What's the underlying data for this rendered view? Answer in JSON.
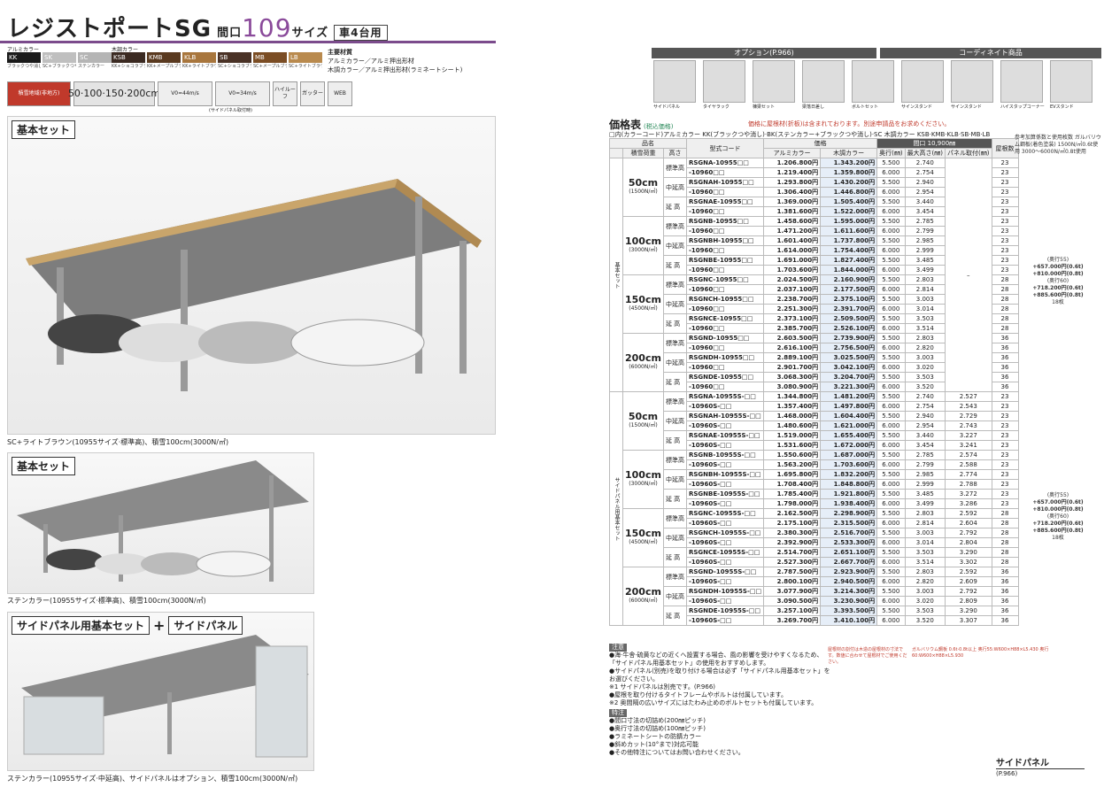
{
  "title": {
    "main": "レジストポートSG",
    "gk": "間口",
    "num": "109",
    "size": "サイズ",
    "badge": "車4台用"
  },
  "swatches": {
    "alum_label": "アルミカラー",
    "wood_label": "木調カラー",
    "alum": [
      {
        "code": "KK",
        "cap": "ブラックつや消し",
        "color": "#1a1a1a"
      },
      {
        "code": "SK",
        "cap": "SC+ブラックつや消し",
        "color": "#bfbfbf"
      },
      {
        "code": "SC",
        "cap": "ステンカラー",
        "color": "#b5b5b5"
      }
    ],
    "wood": [
      {
        "code": "KSB",
        "cap": "KK+ショコラブラウン",
        "color": "#3b2a22"
      },
      {
        "code": "KMB",
        "cap": "KK+メープルブラウン",
        "color": "#5a3a20"
      },
      {
        "code": "KLB",
        "cap": "KK+ライトブラウン",
        "color": "#a8763d"
      },
      {
        "code": "SB",
        "cap": "SC+ショコラブラウン",
        "color": "#4a3226"
      },
      {
        "code": "MB",
        "cap": "SC+メープルブラウン",
        "color": "#7b4d24"
      },
      {
        "code": "LB",
        "cap": "SC+ライトブラウン",
        "color": "#b98a4e"
      }
    ]
  },
  "material": {
    "head": "主要材質",
    "l1": "アルミカラー／アルミ押出形材",
    "l2": "木調カラー／アルミ押出形材(ラミネートシート)"
  },
  "icons": {
    "red": "積雪地域(非地方)",
    "snow": "50·100·150·200cm",
    "wind1": "V0=44m/s",
    "wind2": "V0=34m/s",
    "side_cap": "(サイドパネル取付時)",
    "hi": "ハイルーフ",
    "gutter": "ガッター",
    "web": "WEB"
  },
  "sections": {
    "basic1": "基本セット",
    "caption1": "SC+ライトブラウン(10955サイズ·標準高)、積雪100cm(3000N/㎡)",
    "basic2": "基本セット",
    "caption2": "ステンカラー(10955サイズ·標準高)、積雪100cm(3000N/㎡)",
    "side_set": "サイドパネル用基本セット",
    "plus": "+",
    "side_panel": "サイドパネル",
    "caption3": "ステンカラー(10955サイズ·中延高)、サイドパネルはオプション、積雪100cm(3000N/㎡)"
  },
  "options": {
    "header": "オプション(P.966)",
    "coord_header": "コーディネイト商品",
    "items": [
      "サイドパネル",
      "タイヤラック",
      "棟梁セット",
      "梁落日差し",
      "ボルトセット",
      "サインスタンド",
      "サインスタンド",
      "ハイスタップコーナー",
      "EVスタンド"
    ]
  },
  "price": {
    "title": "価格表",
    "sub": "(税込価格)",
    "note": "価格に屋根材(折板)は含まれております。別途申請品をお求めください。",
    "color_note": "□内(カラーコード)アルミカラー KK(ブラックつや消し)·BK(ステンカラー+ブラックつや消し)·SC 木調カラー KSB·KMB·KLB·SB·MB·LB",
    "headers": {
      "name": "品名",
      "snow": "積雪荷重",
      "height": "高さ",
      "code": "型式コード",
      "price": "価格",
      "alum": "アルミカラー",
      "wood": "木調カラー",
      "size": "間口 10,900㎜",
      "depth": "奥行(㎜)",
      "maxh": "最大高さ(㎜)",
      "panel": "パネル取付(㎜)",
      "roof": "屋根数"
    },
    "groups": [
      {
        "cat": "基本セット",
        "snow": "50cm",
        "snow2": "(1500N/㎡)",
        "rows": [
          [
            "標準高",
            "RSGNA-10955□□",
            "1.206.800円",
            "1.343.200円",
            "5.500",
            "2.740",
            "23"
          ],
          [
            "",
            "-10960□□",
            "1.219.400円",
            "1.359.800円",
            "6.000",
            "2.754",
            "23"
          ],
          [
            "中延高",
            "RSGNAH-10955□□",
            "1.293.800円",
            "1.430.200円",
            "5.500",
            "2.940",
            "23"
          ],
          [
            "",
            "-10960□□",
            "1.306.400円",
            "1.446.800円",
            "6.000",
            "2.954",
            "23"
          ],
          [
            "延 高",
            "RSGNAE-10955□□",
            "1.369.000円",
            "1.505.400円",
            "5.500",
            "3.440",
            "23"
          ],
          [
            "",
            "-10960□□",
            "1.381.600円",
            "1.522.000円",
            "6.000",
            "3.454",
            "23"
          ]
        ]
      },
      {
        "cat": "",
        "snow": "100cm",
        "snow2": "(3000N/㎡)",
        "rows": [
          [
            "標準高",
            "RSGNB-10955□□",
            "1.458.600円",
            "1.595.000円",
            "5.500",
            "2.785",
            "23"
          ],
          [
            "",
            "-10960□□",
            "1.471.200円",
            "1.611.600円",
            "6.000",
            "2.799",
            "23"
          ],
          [
            "中延高",
            "RSGNBH-10955□□",
            "1.601.400円",
            "1.737.800円",
            "5.500",
            "2.985",
            "23"
          ],
          [
            "",
            "-10960□□",
            "1.614.000円",
            "1.754.400円",
            "6.000",
            "2.999",
            "23"
          ],
          [
            "延 高",
            "RSGNBE-10955□□",
            "1.691.000円",
            "1.827.400円",
            "5.500",
            "3.485",
            "23"
          ],
          [
            "",
            "-10960□□",
            "1.703.600円",
            "1.844.000円",
            "6.000",
            "3.499",
            "23"
          ]
        ]
      },
      {
        "cat": "",
        "snow": "150cm",
        "snow2": "(4500N/㎡)",
        "rows": [
          [
            "標準高",
            "RSGNC-10955□□",
            "2.024.500円",
            "2.160.900円",
            "5.500",
            "2.803",
            "28"
          ],
          [
            "",
            "-10960□□",
            "2.037.100円",
            "2.177.500円",
            "6.000",
            "2.814",
            "28"
          ],
          [
            "中延高",
            "RSGNCH-10955□□",
            "2.238.700円",
            "2.375.100円",
            "5.500",
            "3.003",
            "28"
          ],
          [
            "",
            "-10960□□",
            "2.251.300円",
            "2.391.700円",
            "6.000",
            "3.014",
            "28"
          ],
          [
            "延 高",
            "RSGNCE-10955□□",
            "2.373.100円",
            "2.509.500円",
            "5.500",
            "3.503",
            "28"
          ],
          [
            "",
            "-10960□□",
            "2.385.700円",
            "2.526.100円",
            "6.000",
            "3.514",
            "28"
          ]
        ]
      },
      {
        "cat": "",
        "snow": "200cm",
        "snow2": "(6000N/㎡)",
        "rows": [
          [
            "標準高",
            "RSGND-10955□□",
            "2.603.500円",
            "2.739.900円",
            "5.500",
            "2.803",
            "36"
          ],
          [
            "",
            "-10960□□",
            "2.616.100円",
            "2.756.500円",
            "6.000",
            "2.820",
            "36"
          ],
          [
            "中延高",
            "RSGNDH-10955□□",
            "2.889.100円",
            "3.025.500円",
            "5.500",
            "3.003",
            "36"
          ],
          [
            "",
            "-10960□□",
            "2.901.700円",
            "3.042.100円",
            "6.000",
            "3.020",
            "36"
          ],
          [
            "延 高",
            "RSGNDE-10955□□",
            "3.068.300円",
            "3.204.700円",
            "5.500",
            "3.503",
            "36"
          ],
          [
            "",
            "-10960□□",
            "3.080.900円",
            "3.221.300円",
            "6.000",
            "3.520",
            "36"
          ]
        ]
      }
    ],
    "side_groups": [
      {
        "cat": "サイドパネル用基本セット",
        "snow": "50cm",
        "snow2": "(1500N/㎡)",
        "rows": [
          [
            "標準高",
            "RSGNA-10955S-□□",
            "1.344.800円",
            "1.481.200円",
            "5.500",
            "2.740",
            "2.527",
            "23"
          ],
          [
            "",
            "-10960S-□□",
            "1.357.400円",
            "1.497.800円",
            "6.000",
            "2.754",
            "2.543",
            "23"
          ],
          [
            "中延高",
            "RSGNAH-10955S-□□",
            "1.468.000円",
            "1.604.400円",
            "5.500",
            "2.940",
            "2.729",
            "23"
          ],
          [
            "",
            "-10960S-□□",
            "1.480.600円",
            "1.621.000円",
            "6.000",
            "2.954",
            "2.743",
            "23"
          ],
          [
            "延 高",
            "RSGNAE-10955S-□□",
            "1.519.000円",
            "1.655.400円",
            "5.500",
            "3.440",
            "3.227",
            "23"
          ],
          [
            "",
            "-10960S-□□",
            "1.531.600円",
            "1.672.000円",
            "6.000",
            "3.454",
            "3.241",
            "23"
          ]
        ]
      },
      {
        "cat": "",
        "snow": "100cm",
        "snow2": "(3000N/㎡)",
        "rows": [
          [
            "標準高",
            "RSGNB-10955S-□□",
            "1.550.600円",
            "1.687.000円",
            "5.500",
            "2.785",
            "2.574",
            "23"
          ],
          [
            "",
            "-10960S-□□",
            "1.563.200円",
            "1.703.600円",
            "6.000",
            "2.799",
            "2.588",
            "23"
          ],
          [
            "中延高",
            "RSGNBH-10955S-□□",
            "1.695.800円",
            "1.832.200円",
            "5.500",
            "2.985",
            "2.774",
            "23"
          ],
          [
            "",
            "-10960S-□□",
            "1.708.400円",
            "1.848.800円",
            "6.000",
            "2.999",
            "2.788",
            "23"
          ],
          [
            "延 高",
            "RSGNBE-10955S-□□",
            "1.785.400円",
            "1.921.800円",
            "5.500",
            "3.485",
            "3.272",
            "23"
          ],
          [
            "",
            "-10960S-□□",
            "1.798.000円",
            "1.938.400円",
            "6.000",
            "3.499",
            "3.286",
            "23"
          ]
        ]
      },
      {
        "cat": "",
        "snow": "150cm",
        "snow2": "(4500N/㎡)",
        "rows": [
          [
            "標準高",
            "RSGNC-10955S-□□",
            "2.162.500円",
            "2.298.900円",
            "5.500",
            "2.803",
            "2.592",
            "28"
          ],
          [
            "",
            "-10960S-□□",
            "2.175.100円",
            "2.315.500円",
            "6.000",
            "2.814",
            "2.604",
            "28"
          ],
          [
            "中延高",
            "RSGNCH-10955S-□□",
            "2.380.300円",
            "2.516.700円",
            "5.500",
            "3.003",
            "2.792",
            "28"
          ],
          [
            "",
            "-10960S-□□",
            "2.392.900円",
            "2.533.300円",
            "6.000",
            "3.014",
            "2.804",
            "28"
          ],
          [
            "延 高",
            "RSGNCE-10955S-□□",
            "2.514.700円",
            "2.651.100円",
            "5.500",
            "3.503",
            "3.290",
            "28"
          ],
          [
            "",
            "-10960S-□□",
            "2.527.300円",
            "2.667.700円",
            "6.000",
            "3.514",
            "3.302",
            "28"
          ]
        ]
      },
      {
        "cat": "",
        "snow": "200cm",
        "snow2": "(6000N/㎡)",
        "rows": [
          [
            "標準高",
            "RSGND-10955S-□□",
            "2.787.500円",
            "2.923.900円",
            "5.500",
            "2.803",
            "2.592",
            "36"
          ],
          [
            "",
            "-10960S-□□",
            "2.800.100円",
            "2.940.500円",
            "6.000",
            "2.820",
            "2.609",
            "36"
          ],
          [
            "中延高",
            "RSGNDH-10955S-□□",
            "3.077.900円",
            "3.214.300円",
            "5.500",
            "3.003",
            "2.792",
            "36"
          ],
          [
            "",
            "-10960S-□□",
            "3.090.500円",
            "3.230.900円",
            "6.000",
            "3.020",
            "2.809",
            "36"
          ],
          [
            "延 高",
            "RSGNDE-10955S-□□",
            "3.257.100円",
            "3.393.500円",
            "5.500",
            "3.503",
            "3.290",
            "36"
          ],
          [
            "",
            "-10960S-□□",
            "3.269.700円",
            "3.410.100円",
            "6.000",
            "3.520",
            "3.307",
            "36"
          ]
        ]
      }
    ]
  },
  "right_notes": {
    "top": "参考加算係数と使用枚数 ガルバリウム鋼板(着色塗装) 1500N/㎡0.6t使用 3000〜6000N/㎡0.8t使用",
    "a1": "(奥行55)",
    "a2": "+657.000円(0.6t)",
    "a3": "+810.000円(0.8t)",
    "b1": "(奥行60)",
    "b2": "+718.200円(0.6t)",
    "b3": "+885.600円(0.8t)",
    "c": "18枚"
  },
  "notes": {
    "hdr": "注意",
    "l1": "●海·牛舎·硫黄などの近くへ設置する場合、風の影響を受けやすくなるため、「サイドパネル用基本セット」の使用をおすすめします。",
    "l2": "●サイドパネル(別売)を取り付ける場合は必ず「サイドパネル用基本セット」をお選びください。",
    "l3": "※1 サイドパネルは別売です。(P.966)",
    "l4": "●屋根を取り付けるタイトフレームやボルトは付属しています。",
    "l5": "※2 奥間隔の広いサイズにはたわみ止めのボルトセットも付属しています。",
    "hdr2": "特注",
    "s1": "●間口寸法の切詰め(200㎜ピッチ)",
    "s2": "●奥行寸法の切詰め(100㎜ピッチ)",
    "s3": "●ラミネートシートの防錆カラー",
    "s4": "●斜めカット(10°まで)対応可能",
    "s5": "●その他特注についてはお問い合わせください。"
  },
  "warn": {
    "a": "屋根材の割付は木造の屋根材の寸法です。数値に合わせて屋根材でご使用ください。",
    "b": "ガルバリウム鋼板 0.6t·0.8t以上 奥行55:W600×H88×L5.430 奥行60:W600×H88×L5.930"
  },
  "side_footer": {
    "title": "サイドパネル",
    "sub": "(P.966)"
  }
}
